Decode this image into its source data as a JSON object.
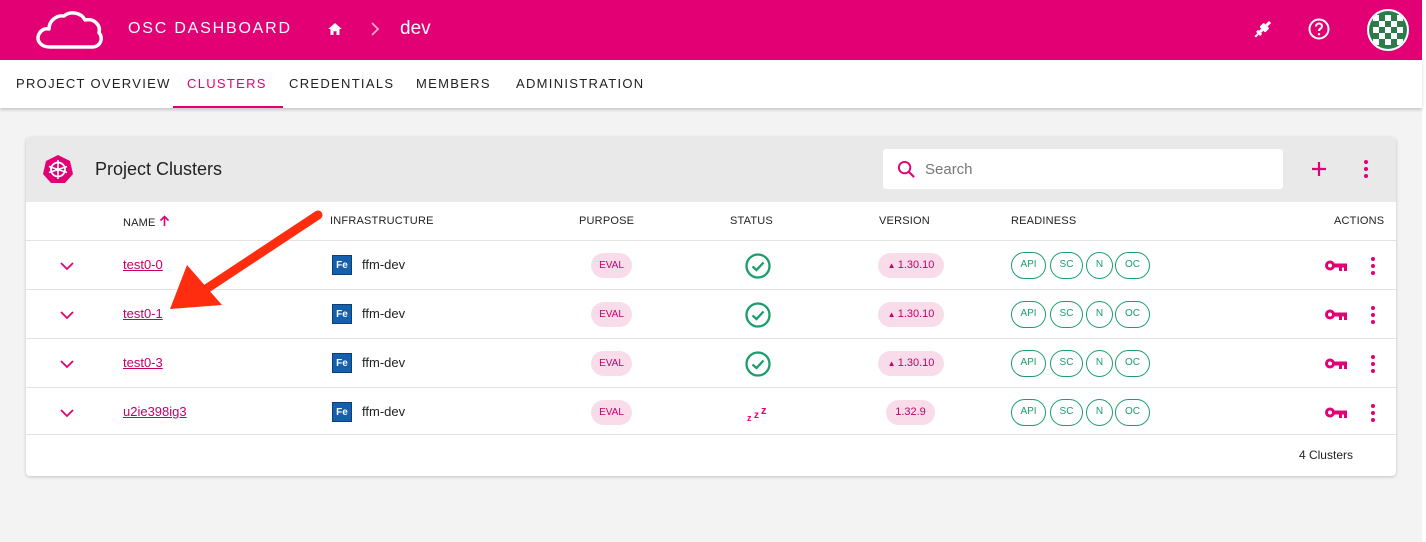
{
  "app": {
    "title": "OSC DASHBOARD",
    "breadcrumb_current": "dev",
    "brand_color": "#e20074"
  },
  "nav": {
    "tabs": [
      {
        "label": "PROJECT OVERVIEW",
        "active": false
      },
      {
        "label": "CLUSTERS",
        "active": true
      },
      {
        "label": "CREDENTIALS",
        "active": false
      },
      {
        "label": "MEMBERS",
        "active": false
      },
      {
        "label": "ADMINISTRATION",
        "active": false
      }
    ]
  },
  "card": {
    "title": "Project Clusters",
    "search_placeholder": "Search",
    "footer_count": "4 Clusters"
  },
  "table": {
    "headers": {
      "name": "NAME",
      "infrastructure": "INFRASTRUCTURE",
      "purpose": "PURPOSE",
      "status": "STATUS",
      "version": "VERSION",
      "readiness": "READINESS",
      "actions": "ACTIONS"
    },
    "sort_indicator": "arrow-up-icon",
    "rows": [
      {
        "name": "test0-0",
        "infra_badge": "Fe",
        "infrastructure": "ffm-dev",
        "purpose": "EVAL",
        "status": "check-circle-icon",
        "version": "1.30.10",
        "version_upgrade": true,
        "readiness": [
          "API",
          "SC",
          "N",
          "OC"
        ]
      },
      {
        "name": "test0-1",
        "infra_badge": "Fe",
        "infrastructure": "ffm-dev",
        "purpose": "EVAL",
        "status": "check-circle-icon",
        "version": "1.30.10",
        "version_upgrade": true,
        "readiness": [
          "API",
          "SC",
          "N",
          "OC"
        ]
      },
      {
        "name": "test0-3",
        "infra_badge": "Fe",
        "infrastructure": "ffm-dev",
        "purpose": "EVAL",
        "status": "check-circle-icon",
        "version": "1.30.10",
        "version_upgrade": true,
        "readiness": [
          "API",
          "SC",
          "N",
          "OC"
        ]
      },
      {
        "name": "u2ie398ig3",
        "infra_badge": "Fe",
        "infrastructure": "ffm-dev",
        "purpose": "EVAL",
        "status": "sleep-zzz-icon",
        "version": "1.32.9",
        "version_upgrade": false,
        "readiness": [
          "API",
          "SC",
          "N",
          "OC"
        ]
      }
    ]
  },
  "colors": {
    "accent": "#e20074",
    "ready": "#1a9e6a",
    "annotation_arrow": "#ff2d10"
  }
}
